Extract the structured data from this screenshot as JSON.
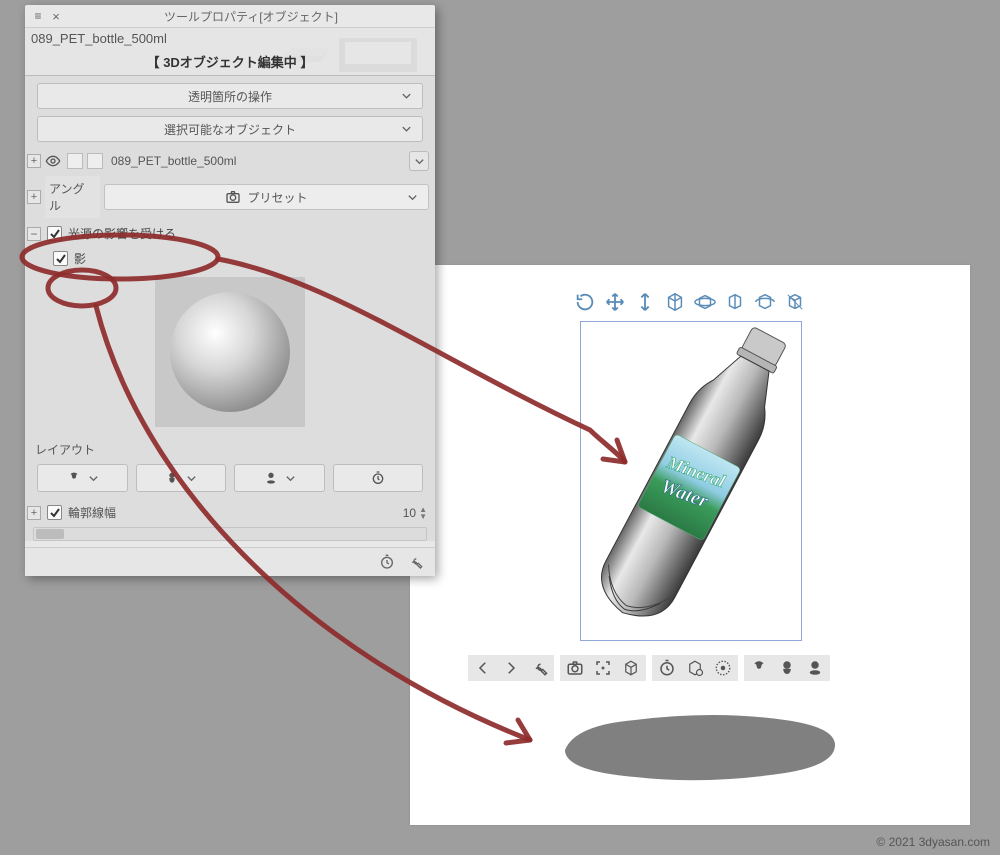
{
  "panel": {
    "title": "ツールプロパティ[オブジェクト]",
    "object_name": "089_PET_bottle_500ml",
    "banner": "【 3Dオブジェクト編集中 】",
    "transparent_ops": "透明箇所の操作",
    "selectable_objs": "選択可能なオブジェクト",
    "item_name": "089_PET_bottle_500ml",
    "angle_label": "アングル",
    "preset_label": "プリセット",
    "light_affect": "光源の影響を受ける",
    "shadow_label": "影",
    "layout_label": "レイアウト",
    "outline_label": "輪郭線幅",
    "outline_value": "10"
  },
  "copyright": "© 2021 3dyasan.com",
  "bottle_label": {
    "line1": "Mineral",
    "line2": "Water"
  }
}
